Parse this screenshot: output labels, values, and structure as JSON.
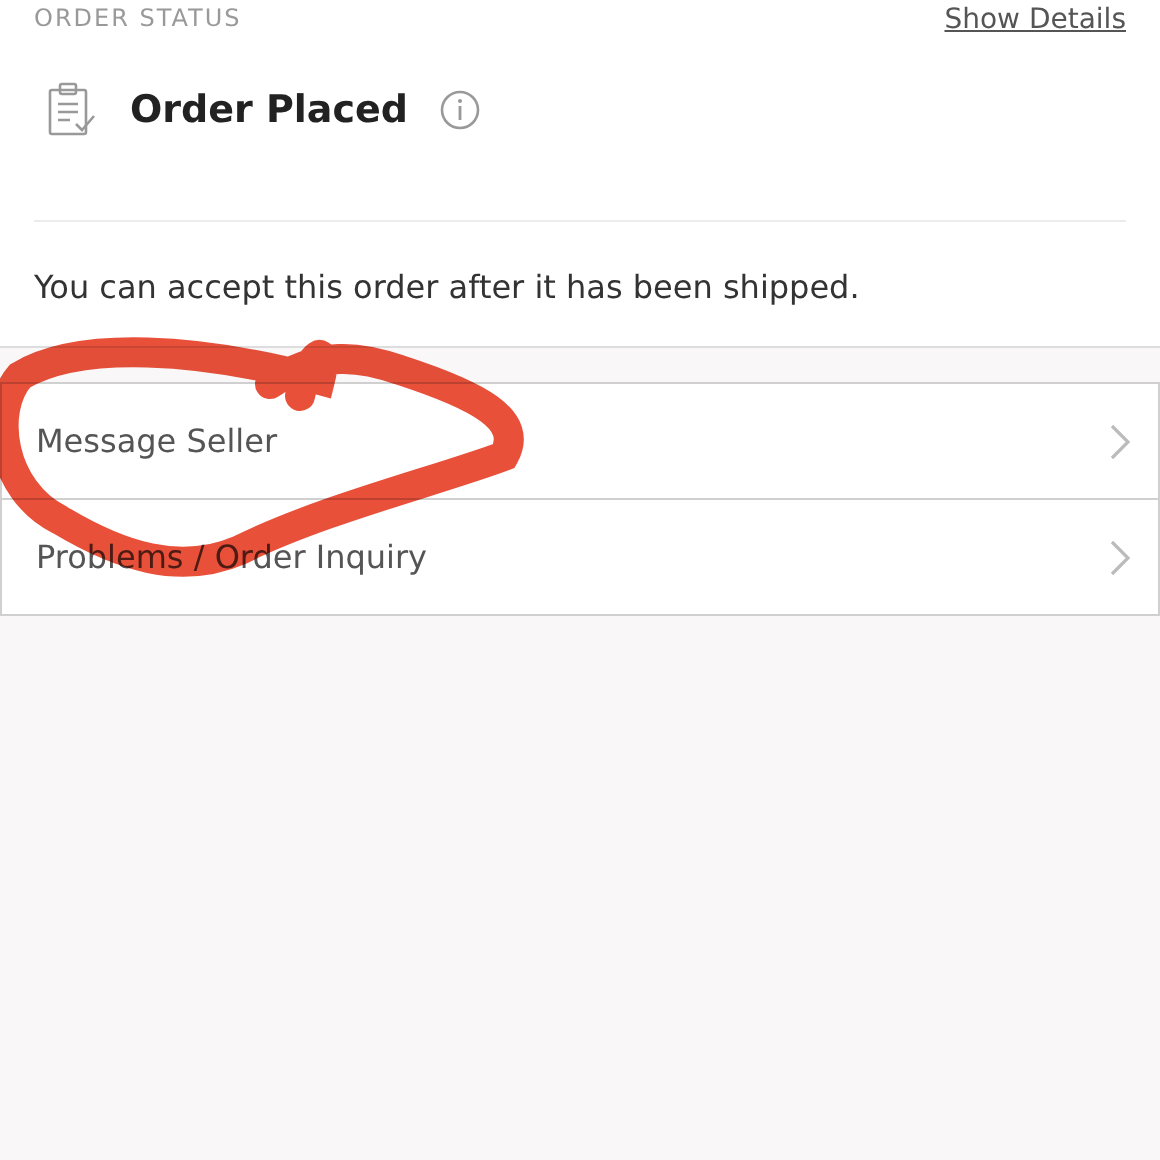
{
  "header": {
    "section_label": "ORDER STATUS",
    "link": "Show Details"
  },
  "status": {
    "title": "Order Placed"
  },
  "note": "You can accept this order after it has been shipped.",
  "menu": [
    {
      "label": "Message Seller"
    },
    {
      "label": "Problems / Order Inquiry"
    }
  ],
  "annotation": {
    "kind": "circle",
    "color": "#e8503a"
  }
}
